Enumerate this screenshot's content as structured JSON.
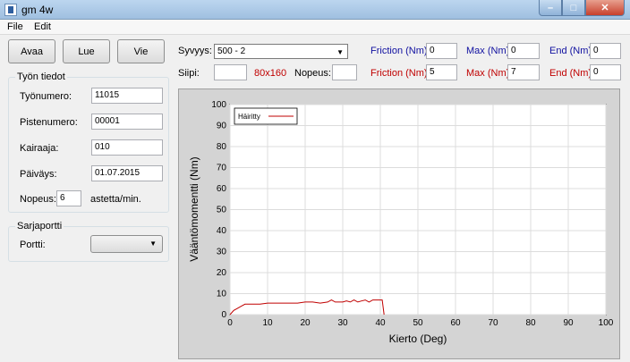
{
  "window": {
    "title": "gm 4w",
    "icon": "app-icon",
    "controls": {
      "min": "–",
      "max": "□",
      "close": "✕"
    }
  },
  "menu": [
    "File",
    "Edit"
  ],
  "toolbar": {
    "open": "Avaa",
    "read": "Lue",
    "export": "Vie"
  },
  "params": {
    "depth_label": "Syvyys:",
    "depth_value": "500 - 2",
    "blade_label": "Siipi:",
    "blade_value": "",
    "blade_size": "80x160",
    "speed_label": "Nopeus:",
    "speed_value": "",
    "row1": {
      "friction_label": "Friction (Nm)",
      "friction_value": "0",
      "max_label": "Max (Nm)",
      "max_value": "0",
      "end_label": "End (Nm)",
      "end_value": "0"
    },
    "row2": {
      "friction_label": "Friction (Nm)",
      "friction_value": "5",
      "max_label": "Max (Nm)",
      "max_value": "7",
      "end_label": "End (Nm)",
      "end_value": "0"
    }
  },
  "work_info": {
    "title": "Työn tiedot",
    "work_number_label": "Työnumero:",
    "work_number": "11015",
    "point_number_label": "Pistenumero:",
    "point_number": "00001",
    "driller_label": "Kairaaja:",
    "driller": "010",
    "date_label": "Päiväys:",
    "date": "01.07.2015",
    "speed_label": "Nopeus:",
    "speed": "6",
    "speed_unit": "astetta/min."
  },
  "serial": {
    "title": "Sarjaportti",
    "port_label": "Portti:",
    "port_value": ""
  },
  "chart_data": {
    "type": "line",
    "xlabel": "Kierto (Deg)",
    "ylabel": "Vääntömomentti (Nm)",
    "xlim": [
      0,
      100
    ],
    "ylim": [
      0,
      100
    ],
    "x_ticks": [
      0,
      10,
      20,
      30,
      40,
      50,
      60,
      70,
      80,
      90,
      100
    ],
    "y_ticks": [
      0,
      10,
      20,
      30,
      40,
      50,
      60,
      70,
      80,
      90,
      100
    ],
    "grid": true,
    "legend_position": "top-left",
    "series": [
      {
        "name": "Häiritty",
        "color": "#c00000",
        "points": [
          [
            0,
            0
          ],
          [
            1,
            2
          ],
          [
            2,
            3
          ],
          [
            3,
            4
          ],
          [
            4,
            5
          ],
          [
            6,
            5
          ],
          [
            8,
            5
          ],
          [
            10,
            5.5
          ],
          [
            12,
            5.5
          ],
          [
            14,
            5.5
          ],
          [
            16,
            5.5
          ],
          [
            18,
            5.5
          ],
          [
            20,
            6
          ],
          [
            22,
            6
          ],
          [
            24,
            5.5
          ],
          [
            26,
            6
          ],
          [
            27,
            7
          ],
          [
            28,
            6
          ],
          [
            29,
            6
          ],
          [
            30,
            6
          ],
          [
            31,
            6.5
          ],
          [
            32,
            6
          ],
          [
            33,
            7
          ],
          [
            34,
            6
          ],
          [
            35,
            6.5
          ],
          [
            36,
            7
          ],
          [
            37,
            6
          ],
          [
            38,
            7
          ],
          [
            39,
            7
          ],
          [
            40,
            7
          ],
          [
            40.5,
            7
          ],
          [
            41,
            0
          ]
        ]
      }
    ]
  }
}
